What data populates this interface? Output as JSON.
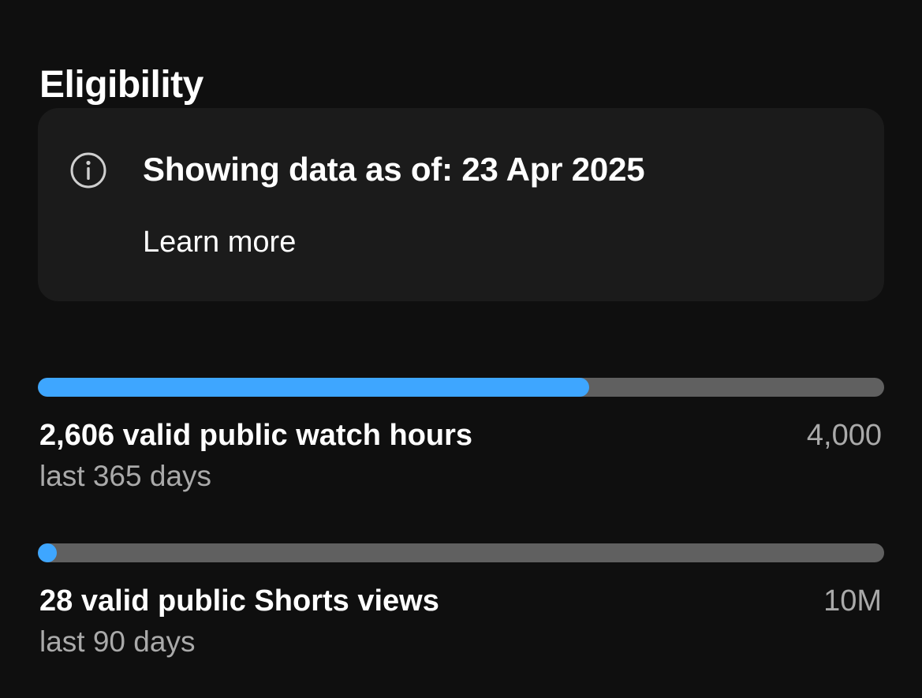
{
  "page": {
    "title": "Eligibility"
  },
  "info_card": {
    "icon": "info-icon",
    "message": "Showing data as of: 23 Apr 2025",
    "link_label": "Learn more"
  },
  "metrics": [
    {
      "label": "2,606 valid public watch hours",
      "period": "last 365 days",
      "goal": "4,000",
      "value": 2606,
      "target": 4000,
      "progress_fraction": 0.651
    },
    {
      "label": "28 valid public Shorts views",
      "period": "last 90 days",
      "goal": "10M",
      "value": 28,
      "target": 10000000,
      "progress_fraction": 2.8e-06
    }
  ],
  "colors": {
    "background": "#0f0f0f",
    "card": "#1b1b1b",
    "progress_fill": "#3ea6ff",
    "progress_track": "#606060",
    "secondary_text": "#aaaaaa"
  }
}
